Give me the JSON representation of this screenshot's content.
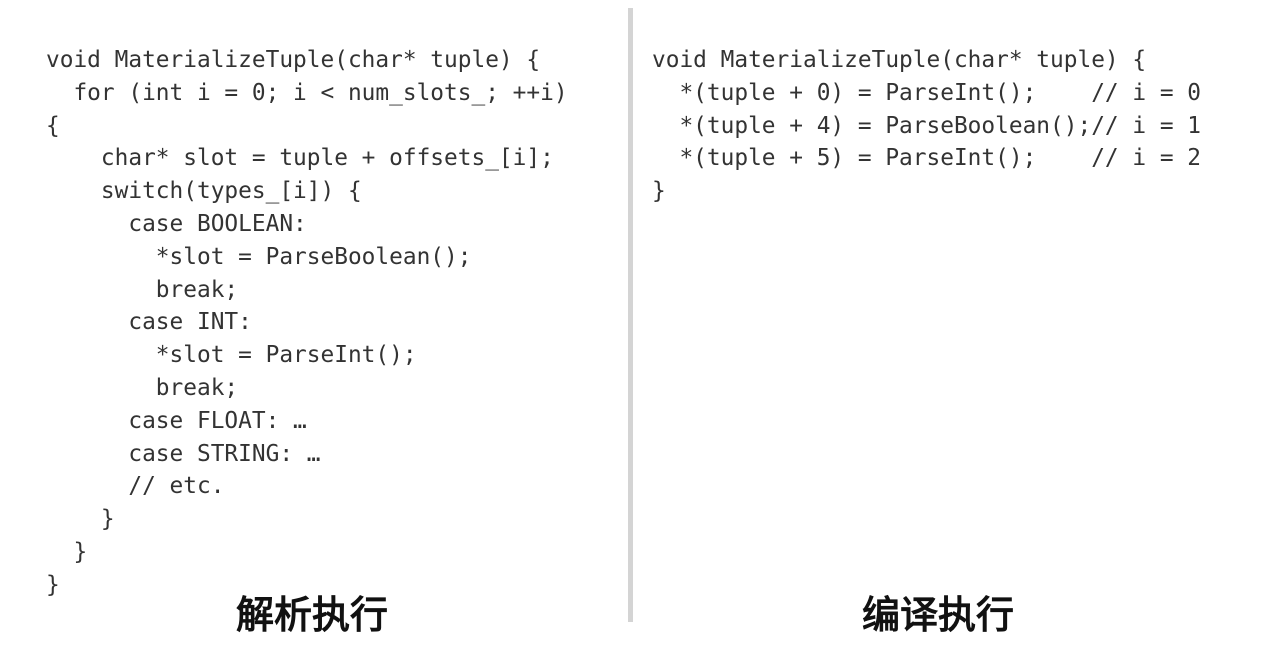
{
  "left": {
    "code": "void MaterializeTuple(char* tuple) {\n  for (int i = 0; i < num_slots_; ++i)\n{\n    char* slot = tuple + offsets_[i];\n    switch(types_[i]) {\n      case BOOLEAN:\n        *slot = ParseBoolean();\n        break;\n      case INT:\n        *slot = ParseInt();\n        break;\n      case FLOAT: …\n      case STRING: …\n      // etc.\n    }\n  }\n}",
    "caption": "解析执行"
  },
  "right": {
    "code": "void MaterializeTuple(char* tuple) {\n  *(tuple + 0) = ParseInt();    // i = 0\n  *(tuple + 4) = ParseBoolean();// i = 1\n  *(tuple + 5) = ParseInt();    // i = 2\n}",
    "caption": "编译执行"
  }
}
